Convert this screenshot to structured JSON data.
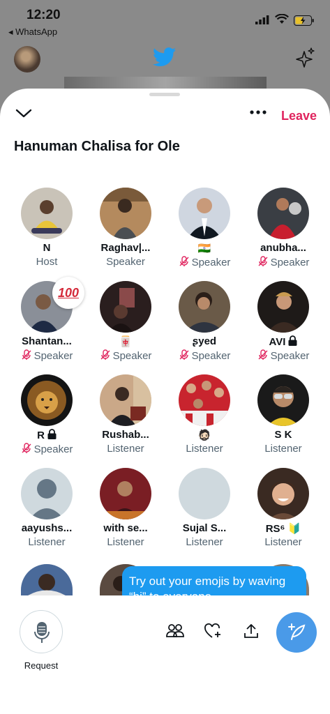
{
  "status": {
    "time": "12:20",
    "back_app": "◂ WhatsApp"
  },
  "header": {
    "leave_label": "Leave",
    "title": "Hanuman Chalisa for Ole"
  },
  "participants": [
    {
      "name": "N",
      "role": "Host",
      "muted": false
    },
    {
      "name": "Raghav|...",
      "role": "Speaker",
      "muted": false
    },
    {
      "name": "🇮🇳",
      "role": "Speaker",
      "muted": true
    },
    {
      "name": "anubha...",
      "role": "Speaker",
      "muted": true
    },
    {
      "name": "Shantan...",
      "role": "Speaker",
      "muted": true,
      "badge": "100"
    },
    {
      "name": "🀄",
      "role": "Speaker",
      "muted": true
    },
    {
      "name": "ʂyed",
      "role": "Speaker",
      "muted": true
    },
    {
      "name": "AVI",
      "role": "Speaker",
      "muted": true,
      "locked": true
    },
    {
      "name": "R",
      "role": "Speaker",
      "muted": true,
      "locked": true
    },
    {
      "name": "Rushab...",
      "role": "Listener",
      "muted": false
    },
    {
      "name": "🧔🏻",
      "role": "Listener",
      "muted": false
    },
    {
      "name": "S K",
      "role": "Listener",
      "muted": false
    },
    {
      "name": "aayushs...",
      "role": "Listener",
      "muted": false
    },
    {
      "name": "with se...",
      "role": "Listener",
      "muted": false
    },
    {
      "name": "Sujal S...",
      "role": "Listener",
      "muted": false
    },
    {
      "name": "RS⁶ 🔰",
      "role": "Listener",
      "muted": false
    }
  ],
  "tooltip": {
    "text": "Try out your emojis by waving “hi” to everyone"
  },
  "bottom": {
    "request_label": "Request"
  },
  "colors": {
    "accent": "#1d9bf0",
    "leave": "#e0245e",
    "muted_mic": "#e0245e",
    "secondary_text": "#536471"
  }
}
